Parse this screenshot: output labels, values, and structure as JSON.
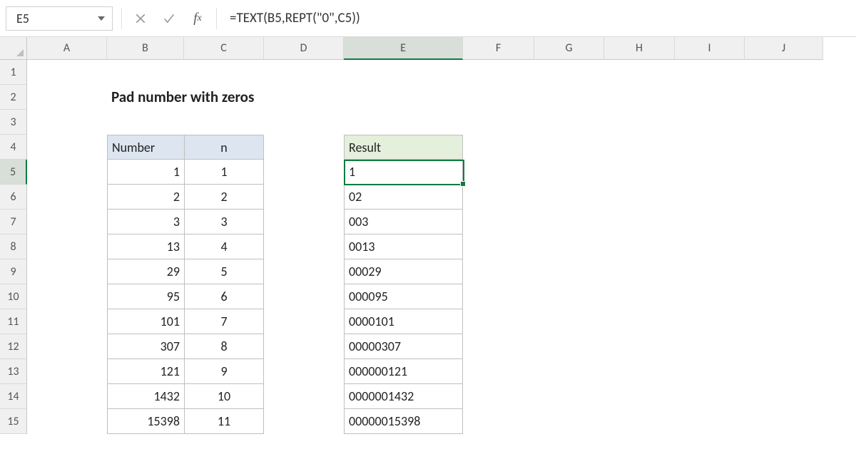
{
  "selected_cell": "E5",
  "formula": "=TEXT(B5,REPT(\"0\",C5))",
  "title": "Pad number with zeros",
  "columns": [
    "A",
    "B",
    "C",
    "D",
    "E",
    "F",
    "G",
    "H",
    "I",
    "J"
  ],
  "rows": [
    "1",
    "2",
    "3",
    "4",
    "5",
    "6",
    "7",
    "8",
    "9",
    "10",
    "11",
    "12",
    "13",
    "14",
    "15"
  ],
  "headers": {
    "number": "Number",
    "n": "n",
    "result": "Result"
  },
  "data_rows": [
    {
      "number": "1",
      "n": "1",
      "result": "1"
    },
    {
      "number": "2",
      "n": "2",
      "result": "02"
    },
    {
      "number": "3",
      "n": "3",
      "result": "003"
    },
    {
      "number": "13",
      "n": "4",
      "result": "0013"
    },
    {
      "number": "29",
      "n": "5",
      "result": "00029"
    },
    {
      "number": "95",
      "n": "6",
      "result": "000095"
    },
    {
      "number": "101",
      "n": "7",
      "result": "0000101"
    },
    {
      "number": "307",
      "n": "8",
      "result": "00000307"
    },
    {
      "number": "121",
      "n": "9",
      "result": "000000121"
    },
    {
      "number": "1432",
      "n": "10",
      "result": "0000001432"
    },
    {
      "number": "15398",
      "n": "11",
      "result": "00000015398"
    }
  ],
  "colors": {
    "selection": "#107c41",
    "header_blue": "#dde6f0",
    "header_green": "#e4efdc"
  }
}
